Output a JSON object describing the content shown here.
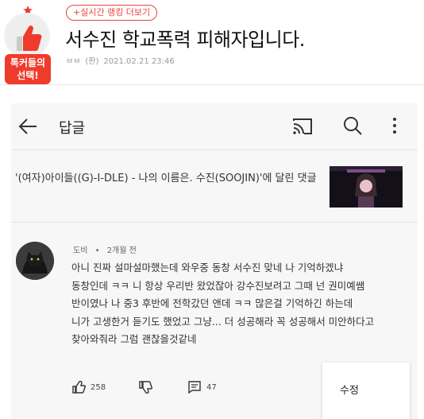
{
  "badge": {
    "label_line1": "톡커들의",
    "label_line2": "선택!"
  },
  "rank_link": "+실시간 랭킹 더보기",
  "post": {
    "title": "서수진 학교폭력 피해자입니다.",
    "author": "ㅂㅂ",
    "author_tag": "(판)",
    "datetime": "2021.02.21 23:46"
  },
  "screenshot": {
    "appbar_title": "답글",
    "video_title": "'(여자)아이들((G)-I-DLE) - 나의 이름은. 수진(SOOJIN)'에 달린 댓글",
    "comment": {
      "author": "도비",
      "separator": "•",
      "time": "2개월 전",
      "lines": [
        "아니 진짜 설마설마했는데 와우중 동창 서수진 맞네 나 기억하겠냐",
        "동창인데 ㅋㅋ 니 항상 우리반 왔었잖아 강수진보려고 그때 넌 권미예쌤",
        "반이였나  나 중3 후반에 전학갔던 앤데 ㅋㅋ 많은걸 기억하긴 하는데",
        "니가 고생한거 듣기도 했었고 그냥... 더 성공해라 꼭 성공해서 미안하다고",
        "찾아와줘라 그럼 괜찮을것같네"
      ],
      "likes": "258",
      "replies": "47"
    },
    "popup_item": "수정"
  },
  "colors": {
    "accent": "#e8453c",
    "badge": "#ef3b2c"
  },
  "icons": [
    "star-icon",
    "thumbs-up-icon",
    "back-arrow-icon",
    "cast-icon",
    "search-icon",
    "more-vert-icon",
    "like-icon",
    "dislike-icon",
    "reply-icon"
  ]
}
